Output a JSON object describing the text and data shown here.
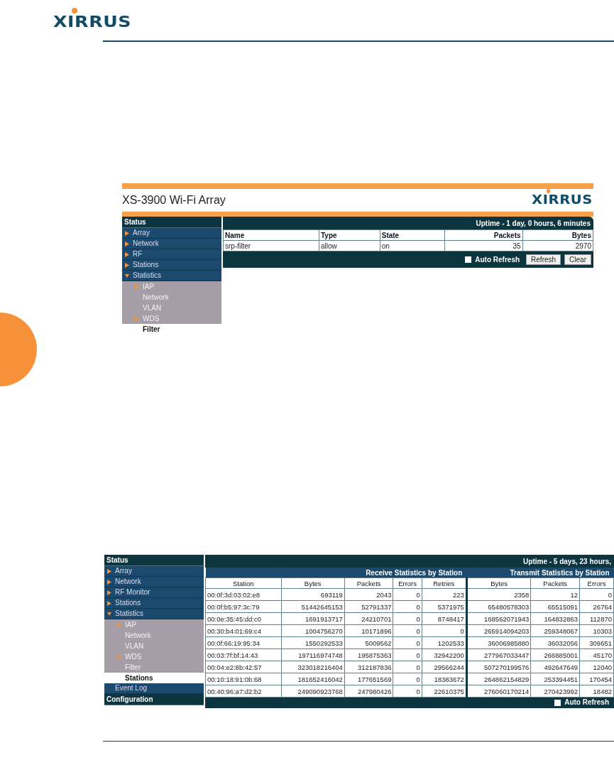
{
  "header": {
    "logo": "XIRRUS"
  },
  "filter_screen": {
    "title": "XS-3900 Wi-Fi Array",
    "logo": "XIRRUS",
    "nav": [
      {
        "kind": "section",
        "label": "Status"
      },
      {
        "kind": "item",
        "label": "Array",
        "expanded": false,
        "selected": false
      },
      {
        "kind": "item",
        "label": "Network",
        "expanded": false,
        "selected": false
      },
      {
        "kind": "item",
        "label": "RF",
        "expanded": false,
        "selected": false
      },
      {
        "kind": "item",
        "label": "Stations",
        "expanded": false,
        "selected": false
      },
      {
        "kind": "item",
        "label": "Statistics",
        "expanded": true,
        "selected": false,
        "children": [
          {
            "label": "IAP",
            "expanded": false,
            "selected": false
          },
          {
            "label": "Network",
            "selected": false
          },
          {
            "label": "VLAN",
            "selected": false
          },
          {
            "label": "WDS",
            "expanded": false,
            "selected": false
          },
          {
            "label": "Filter",
            "selected": true
          }
        ]
      }
    ],
    "uptime": "Uptime - 1 day, 0 hours, 6 minutes",
    "columns": [
      "Name",
      "Type",
      "State",
      "Packets",
      "Bytes"
    ],
    "rows": [
      [
        "srp-filter",
        "allow",
        "on",
        "35",
        "2970"
      ]
    ],
    "auto_refresh": {
      "label": "Auto Refresh",
      "checked": false
    },
    "buttons": [
      "Refresh",
      "Clear"
    ]
  },
  "stations_screen": {
    "nav": [
      {
        "kind": "section",
        "label": "Status"
      },
      {
        "kind": "item",
        "label": "Array",
        "expanded": false,
        "selected": false
      },
      {
        "kind": "item",
        "label": "Network",
        "expanded": false,
        "selected": false
      },
      {
        "kind": "item",
        "label": "RF Monitor",
        "expanded": false,
        "selected": false
      },
      {
        "kind": "item",
        "label": "Stations",
        "expanded": false,
        "selected": false
      },
      {
        "kind": "item",
        "label": "Statistics",
        "expanded": true,
        "selected": false,
        "children": [
          {
            "label": "IAP",
            "expanded": false,
            "selected": false
          },
          {
            "label": "Network",
            "selected": false
          },
          {
            "label": "VLAN",
            "selected": false
          },
          {
            "label": "WDS",
            "expanded": false,
            "selected": false
          },
          {
            "label": "Filter",
            "selected": false
          },
          {
            "label": "Stations",
            "selected": true
          }
        ]
      },
      {
        "kind": "item",
        "label": "Event Log",
        "selected": false
      },
      {
        "kind": "section",
        "label": "Configuration"
      }
    ],
    "uptime": "Uptime - 5 days, 23 hours,",
    "groups": [
      "Receive Statistics by Station",
      "Transmit Statistics by Station"
    ],
    "columns": [
      "Station",
      "Bytes",
      "Packets",
      "Errors",
      "Retries",
      "Bytes",
      "Packets",
      "Errors"
    ],
    "rows": [
      [
        "00:0f:3d:03:02:e8",
        "693119",
        "2043",
        "0",
        "223",
        "2358",
        "12",
        "0"
      ],
      [
        "00:0f:b5:97:3c:79",
        "51442645153",
        "52791337",
        "0",
        "5371975",
        "65480578303",
        "65515091",
        "26764"
      ],
      [
        "00:0e:35:45:dd:c0",
        "1691913717",
        "24210701",
        "0",
        "8748417",
        "168562071943",
        "164832863",
        "112870"
      ],
      [
        "00:30:b4:01:69:c4",
        "1004756270",
        "10171896",
        "0",
        "0",
        "265914094203",
        "259348067",
        "10303"
      ],
      [
        "00:0f:66:19:95:34",
        "1550292533",
        "5009562",
        "0",
        "1202533",
        "36006985880",
        "36032056",
        "309651"
      ],
      [
        "00:03:7f:bf:14:43",
        "197116974748",
        "195875363",
        "0",
        "32942200",
        "277967033447",
        "266885001",
        "45170"
      ],
      [
        "00:04:e2:8b:42:57",
        "323018216404",
        "312187836",
        "0",
        "29566244",
        "507270199576",
        "492647649",
        "12040"
      ],
      [
        "00:10:18:91:0b:68",
        "181652416042",
        "177651569",
        "0",
        "18383672",
        "264862154829",
        "253394451",
        "170454"
      ],
      [
        "00:40:96:a7:d2:b2",
        "249090923768",
        "247980426",
        "0",
        "22610375",
        "276060170214",
        "270423992",
        "18482"
      ]
    ],
    "auto_refresh": {
      "label": "Auto Refresh",
      "checked": false
    }
  }
}
